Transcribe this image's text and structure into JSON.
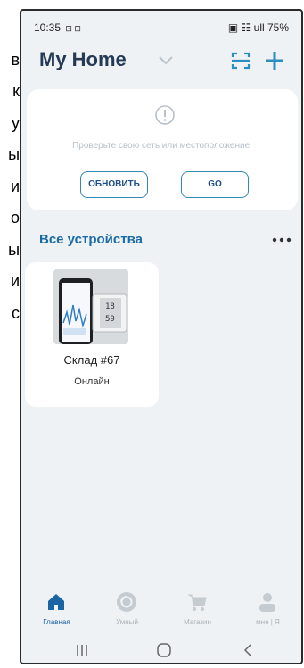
{
  "edge_text": [
    "в",
    "к",
    "у",
    "ы",
    "и",
    "о",
    "ы",
    "и",
    "с"
  ],
  "status_bar": {
    "time": "10:35",
    "time_icons": "⊡ ⊡",
    "right": "▣ ☷ ull 75%"
  },
  "header": {
    "title": "My Home"
  },
  "warning_card": {
    "message": "Проверьте свою сеть или местоположение.",
    "refresh_label": "ОБНОВИТЬ",
    "go_label": "GO"
  },
  "devices_section": {
    "title": "Все устройства"
  },
  "devices": [
    {
      "name": "Склад #67",
      "status": "Онлайн"
    }
  ],
  "tabs": [
    {
      "label": "Главная",
      "icon": "home-icon",
      "active": true
    },
    {
      "label": "Умный",
      "icon": "smart-icon",
      "active": false
    },
    {
      "label": "Магазин",
      "icon": "cart-icon",
      "active": false
    },
    {
      "label": "мне | Я",
      "icon": "profile-icon",
      "active": false
    }
  ],
  "colors": {
    "accent": "#1a64a3",
    "background": "#eef2f4",
    "card": "#ffffff"
  }
}
